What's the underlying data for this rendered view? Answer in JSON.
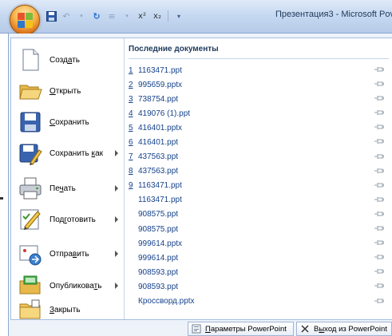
{
  "window": {
    "title": "Презентация3 - Microsoft Pov"
  },
  "colors": {
    "accent": "#15428b",
    "menu_border": "#a7bedf",
    "office_button": "#f7b34a"
  },
  "quick_access": {
    "icons": [
      "save-icon",
      "undo-icon",
      "redo-icon",
      "bullets-icon",
      "close-format-icon",
      "customize-icon"
    ]
  },
  "commands": [
    {
      "label_pre": "Созд",
      "label_u": "а",
      "label_post": "ть",
      "icon": "new-document-icon",
      "has_submenu": false
    },
    {
      "label_pre": "",
      "label_u": "О",
      "label_post": "ткрыть",
      "icon": "open-folder-icon",
      "has_submenu": false
    },
    {
      "label_pre": "",
      "label_u": "С",
      "label_post": "охранить",
      "icon": "save-icon",
      "has_submenu": false
    },
    {
      "label_pre": "Сохранить ",
      "label_u": "к",
      "label_post": "ак",
      "icon": "save-as-icon",
      "has_submenu": true
    },
    {
      "label_pre": "Пе",
      "label_u": "ч",
      "label_post": "ать",
      "icon": "printer-icon",
      "has_submenu": true
    },
    {
      "label_pre": "Под",
      "label_u": "г",
      "label_post": "отовить",
      "icon": "prepare-pencil-icon",
      "has_submenu": true
    },
    {
      "label_pre": "Отпра",
      "label_u": "в",
      "label_post": "ить",
      "icon": "send-icon",
      "has_submenu": true
    },
    {
      "label_pre": "Опубликова",
      "label_u": "т",
      "label_post": "ь",
      "icon": "publish-icon",
      "has_submenu": true
    },
    {
      "label_pre": "",
      "label_u": "З",
      "label_post": "акрыть",
      "icon": "close-folder-icon",
      "has_submenu": false
    }
  ],
  "recent": {
    "header": "Последние документы",
    "items": [
      {
        "num": "1",
        "name": "1163471.ppt"
      },
      {
        "num": "2",
        "name": "995659.pptx"
      },
      {
        "num": "3",
        "name": "738754.ppt"
      },
      {
        "num": "4",
        "name": "419076 (1).ppt"
      },
      {
        "num": "5",
        "name": "416401.pptx"
      },
      {
        "num": "6",
        "name": "416401.ppt"
      },
      {
        "num": "7",
        "name": "437563.ppt"
      },
      {
        "num": "8",
        "name": "437563.ppt"
      },
      {
        "num": "9",
        "name": "1163471.ppt"
      },
      {
        "num": "",
        "name": "1163471.ppt"
      },
      {
        "num": "",
        "name": "908575.ppt"
      },
      {
        "num": "",
        "name": "908575.ppt"
      },
      {
        "num": "",
        "name": "999614.pptx"
      },
      {
        "num": "",
        "name": "999614.ppt"
      },
      {
        "num": "",
        "name": "908593.ppt"
      },
      {
        "num": "",
        "name": "908593.ppt"
      },
      {
        "num": "",
        "name": "Кроссворд.pptx"
      }
    ]
  },
  "bottom": {
    "params_pre": "",
    "params_u": "П",
    "params_post": "араметры PowerPoint",
    "exit_pre": "В",
    "exit_u": "ы",
    "exit_post": "ход из PowerPoint"
  }
}
